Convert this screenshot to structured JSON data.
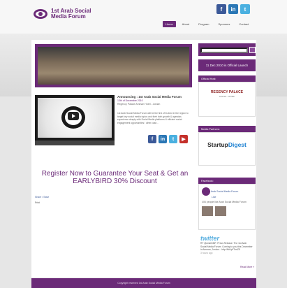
{
  "header": {
    "logo_line1": "1st Arab Social",
    "logo_line2": "Media Forum",
    "social": [
      "f",
      "in",
      "t"
    ],
    "nav": [
      "Home",
      "About",
      "Program",
      "Sponsors",
      "Contact"
    ]
  },
  "announcement": {
    "title": "Announcing : 1st Arab Social Media Forum",
    "date": "13th of December 2010",
    "venue": "Regency Palace Amman Hotel - Jordan",
    "body": "1st Arab Social Media Forum will be the first of its kind in the region to target key social media topics and their both growth & agendas experience deeply with Social Media platforms & efficient social engagement opportunities / other case..."
  },
  "register": {
    "text": "Register Now to Guarantee Your Seat & Get an EARLYBIRD 30% Discount"
  },
  "share": {
    "share_label": "Share / Save",
    "print_label": "Print"
  },
  "sidebar": {
    "search_placeholder": "",
    "launch": "11 Dec 2010 is Official Launch",
    "official_host": "Official Host:",
    "regency_name": "REGENCY PALACE",
    "regency_sub": "Amman - Jordan",
    "media_partners": "Media Partners:",
    "startup_a": "Startup",
    "startup_b": "Digest",
    "facebook_header": "Facebook:",
    "fb_page": "Arab Social Media Forum",
    "fb_like": "Like",
    "fb_people": "406 people like Arab Social Media Forum",
    "twitter": "twitter",
    "tweet": "RT @ArabSMF: Press Release: The 1st Arab Social Media Forum: Coming to you this December in Amman, Jordan... http://bit.ly/fTrmZ5",
    "tweet_time": "3 hours ago",
    "read_more": "Read More »"
  },
  "footer": {
    "copyright": "Copyright reserved 1st Arab Social Media Forum"
  },
  "colors": {
    "brand": "#6b2a78",
    "facebook": "#3b5998",
    "linkedin": "#2b77b5",
    "twitter": "#4ab0e0",
    "youtube": "#c4302b"
  }
}
